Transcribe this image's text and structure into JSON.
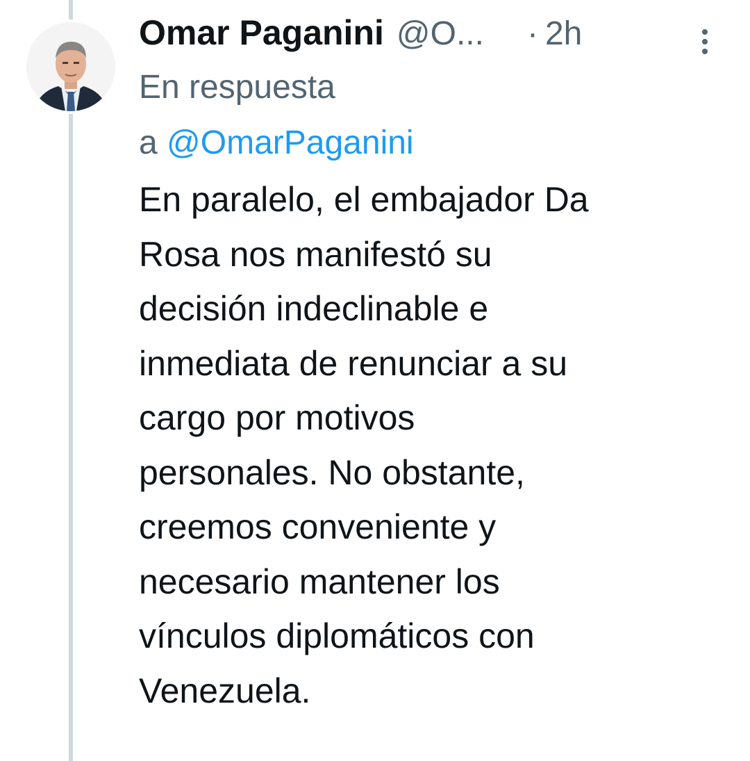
{
  "tweet": {
    "author": {
      "display_name": "Omar Paganini",
      "handle": "@O...",
      "avatar": "profile-photo"
    },
    "timestamp_separator": "·",
    "timestamp": "2h",
    "more_icon": "vertical-ellipsis-icon",
    "reply_prefix_line1": "En respuesta",
    "reply_prefix_line2": "a",
    "reply_to": "@OmarPaganini",
    "text": "En paralelo, el embajador Da\nRosa nos manifestó su\ndecisión indeclinable e\ninmediata de renunciar a su\ncargo por motivos\npersonales. No obstante,\ncreemos conveniente y\nnecesario mantener los\nvínculos diplomáticos con\nVenezuela."
  },
  "colors": {
    "text_primary": "#0f1419",
    "text_secondary": "#536471",
    "link": "#1d9bf0",
    "thread_line": "#cfd9de"
  }
}
